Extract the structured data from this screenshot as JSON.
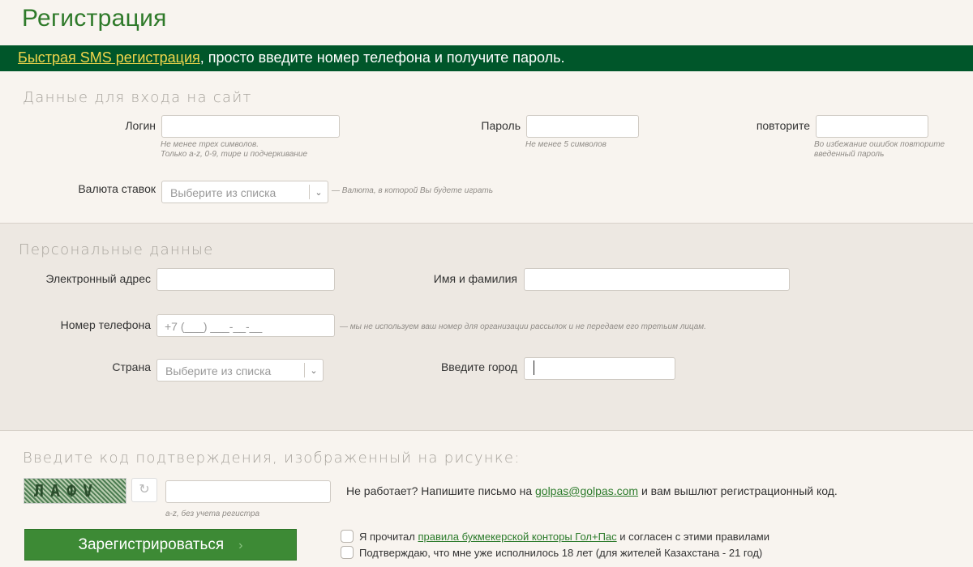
{
  "page": {
    "title": "Регистрация"
  },
  "banner": {
    "link": "Быстрая SMS регистрация",
    "text": ", просто введите номер телефона и получите пароль."
  },
  "login_section": {
    "title": "Данные для входа на сайт",
    "login_label": "Логин",
    "login_value": "",
    "login_hint_1": "Не менее трех символов.",
    "login_hint_2": "Только a-z, 0-9, тире и подчеркивание",
    "password_label": "Пароль",
    "password_value": "",
    "password_hint": "Не менее 5 символов",
    "repeat_label": "повторите",
    "repeat_value": "",
    "repeat_hint_1": "Во избежание ошибок повторите",
    "repeat_hint_2": "введенный пароль",
    "currency_label": "Валюта ставок",
    "currency_placeholder": "Выберите из списка",
    "currency_hint": "— Валюта, в которой Вы будете играть"
  },
  "personal_section": {
    "title": "Персональные данные",
    "email_label": "Электронный адрес",
    "email_value": "",
    "name_label": "Имя и фамилия",
    "name_value": "",
    "phone_label": "Номер телефона",
    "phone_placeholder": "+7 (___) ___-__-__",
    "phone_hint": "— мы не используем ваш номер для организации рассылок и не передаем его третьим лицам.",
    "country_label": "Страна",
    "country_placeholder": "Выберите из списка",
    "city_label": "Введите город",
    "city_value": ""
  },
  "captcha_section": {
    "title": "Введите код подтверждения, изображенный на рисунке:",
    "captcha_text": "ЛАФV",
    "captcha_value": "",
    "captcha_hint": "a-z, без учета регистра",
    "notice_before": "Не работает? Напишите письмо на ",
    "notice_email": "golpas@golpas.com",
    "notice_after": " и вам вышлют регистрационный код."
  },
  "register_button": {
    "label": "Зарегистрироваться",
    "chevron": "›"
  },
  "agreements": {
    "rules_before": "Я прочитал ",
    "rules_link": "правила букмекерской конторы Гол+Пас",
    "rules_after": " и согласен с этими правилами",
    "age_text": "Подтверждаю, что мне уже исполнилось 18 лет (для жителей Казахстана - 21 год)"
  },
  "icons": {
    "refresh": "refresh-icon",
    "dropdown": "chevron-down-icon"
  },
  "colors": {
    "brand_green": "#2f7a2a",
    "banner_bg": "#00562a",
    "link_yellow": "#f1d64c",
    "button_green": "#3d8a35"
  }
}
